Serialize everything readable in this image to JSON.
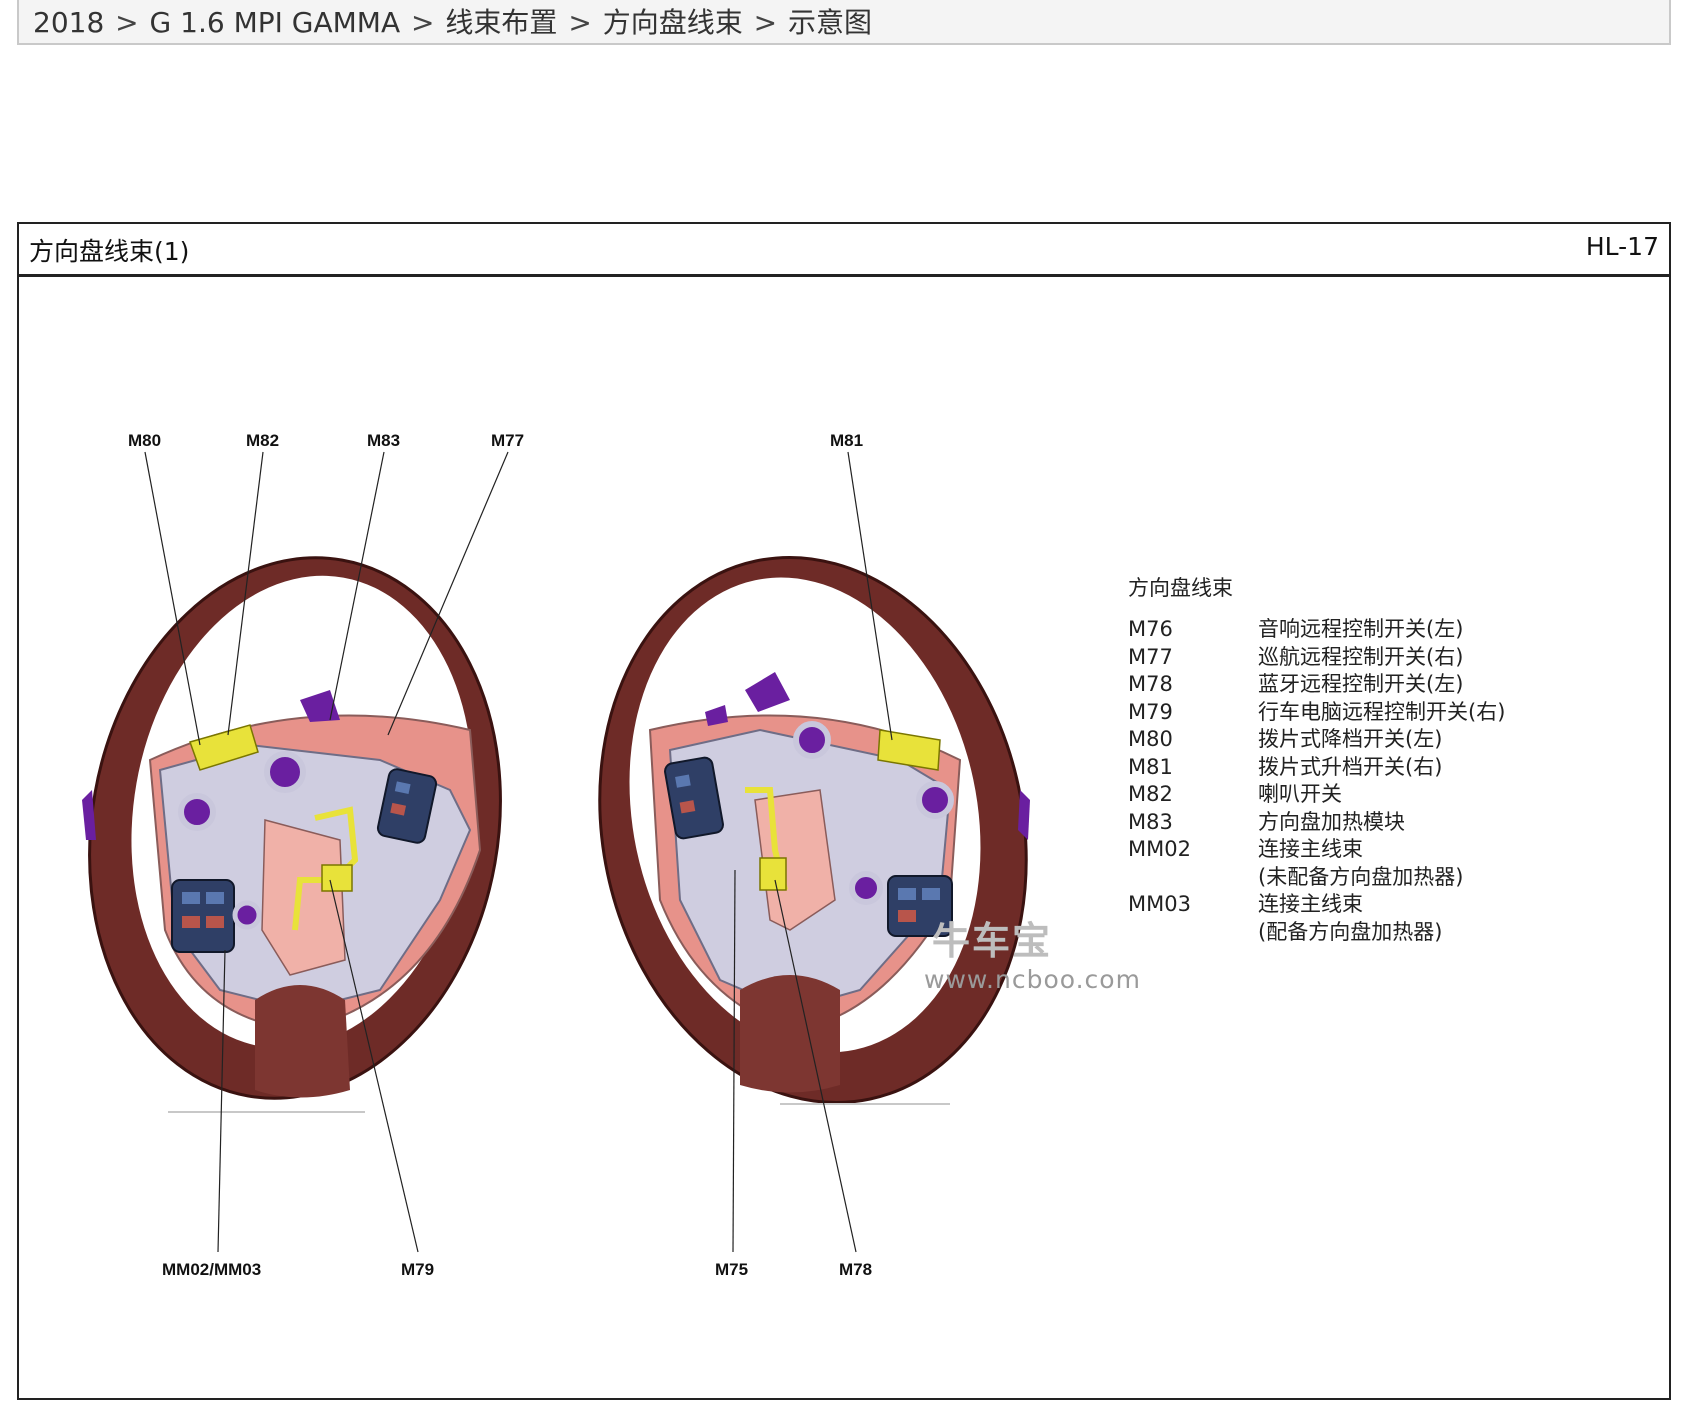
{
  "breadcrumb": {
    "items": [
      "2018",
      "G 1.6 MPI GAMMA",
      "线束布置",
      "方向盘线束",
      "示意图"
    ],
    "separator": ">"
  },
  "panel": {
    "title": "方向盘线束(1)",
    "code": "HL-17"
  },
  "callouts": {
    "top_left": [
      "M80",
      "M82",
      "M83",
      "M77"
    ],
    "top_right": [
      "M81"
    ],
    "bottom_left": [
      "MM02/MM03",
      "M79"
    ],
    "bottom_right": [
      "M75",
      "M78"
    ]
  },
  "legend": {
    "title": "方向盘线束",
    "entries": [
      {
        "code": "M76",
        "desc": "音响远程控制开关(左)"
      },
      {
        "code": "M77",
        "desc": "巡航远程控制开关(右)"
      },
      {
        "code": "M78",
        "desc": "蓝牙远程控制开关(左)"
      },
      {
        "code": "M79",
        "desc": "行车电脑远程控制开关(右)"
      },
      {
        "code": "M80",
        "desc": "拨片式降档开关(左)"
      },
      {
        "code": "M81",
        "desc": "拨片式升档开关(右)"
      },
      {
        "code": "M82",
        "desc": "喇叭开关"
      },
      {
        "code": "M83",
        "desc": "方向盘加热模块"
      },
      {
        "code": "MM02",
        "desc": "连接主线束"
      },
      {
        "code": "",
        "desc": "(未配备方向盘加热器)"
      },
      {
        "code": "MM03",
        "desc": "连接主线束"
      },
      {
        "code": "",
        "desc": "(配备方向盘加热器)"
      }
    ]
  },
  "watermark": {
    "logo": "牛车宝",
    "url": "www.ncboo.com"
  },
  "colors": {
    "rim": "#6e2b27",
    "hub_pink": "#e7928a",
    "frame": "#c9c7dc",
    "switch_blue": "#2f3f66",
    "paddle_purple": "#6a1fa0",
    "harness_yellow": "#e8e23a"
  }
}
